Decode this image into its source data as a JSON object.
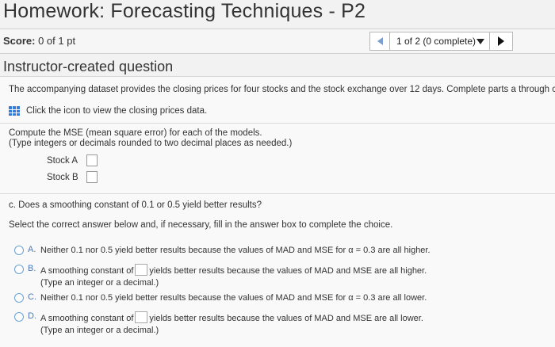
{
  "header": {
    "title": "Homework: Forecasting Techniques - P2",
    "score_label": "Score:",
    "score_value": "0 of 1 pt",
    "nav_select_value": "1 of 2 (0 complete)"
  },
  "section_heading": "Instructor-created question",
  "intro_text": "The accompanying dataset provides the closing prices for four stocks and the stock exchange over 12 days. Complete parts a through c.",
  "data_link_text": "Click the icon to view the closing prices data.",
  "mse": {
    "prompt_line1": "Compute the MSE (mean square error) for each of the models.",
    "prompt_line2": "(Type integers or decimals rounded to two decimal places as needed.)",
    "stocks": [
      {
        "label": "Stock A",
        "value": ""
      },
      {
        "label": "Stock B",
        "value": ""
      }
    ]
  },
  "part_c": {
    "question": "c. Does a smoothing constant of 0.1 or 0.5 yield better results?",
    "instruction": "Select the correct answer below and, if necessary, fill in the answer box to complete the choice.",
    "options": [
      {
        "letter": "A.",
        "text": "Neither 0.1 nor 0.5 yield better results because the values of MAD and MSE for α = 0.3 are all higher."
      },
      {
        "letter": "B.",
        "text_before": "A smoothing constant of",
        "text_after": "yields better results because the values of MAD and MSE are all higher.",
        "hint": "(Type an integer or a decimal.)"
      },
      {
        "letter": "C.",
        "text": "Neither 0.1 nor 0.5 yield better results because the values of MAD and MSE  for α = 0.3 are all lower."
      },
      {
        "letter": "D.",
        "text_before": "A smoothing constant of",
        "text_after": "yields better results because the values of MAD and MSE are all lower.",
        "hint": "(Type an integer or a decimal.)"
      }
    ]
  },
  "colors": {
    "accent": "#3a7bd5",
    "radio_border": "#6aa0d8",
    "option_letter": "#4a78b8"
  },
  "icons": [
    "chevron-left-icon",
    "dropdown-arrow-icon",
    "chevron-right-icon",
    "data-table-icon"
  ]
}
